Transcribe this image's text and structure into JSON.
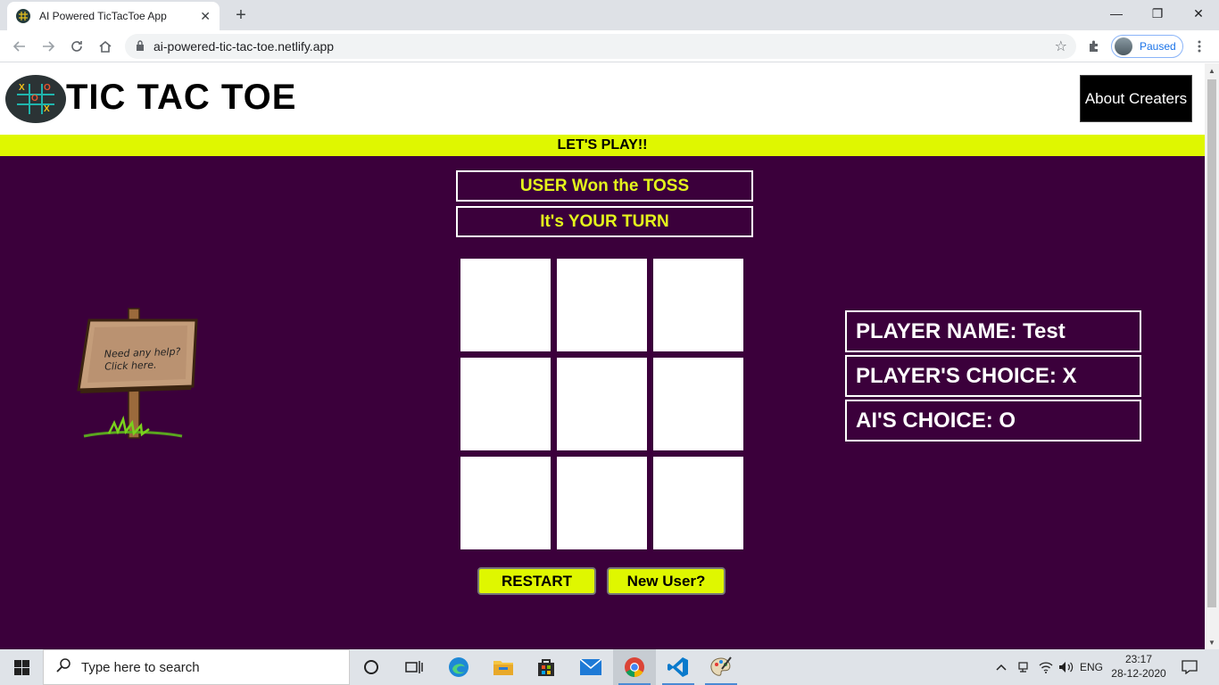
{
  "browser": {
    "tab_title": "AI Powered TicTacToe App",
    "tab_close": "✕",
    "new_tab": "+",
    "url": "ai-powered-tic-tac-toe.netlify.app",
    "profile_status": "Paused",
    "window_controls": {
      "minimize": "—",
      "maximize": "❐",
      "close": "✕"
    }
  },
  "header": {
    "title": "TIC TAC TOE",
    "about_button": "About Creaters",
    "logo_letters": [
      "X",
      "O",
      "X",
      "O"
    ]
  },
  "banner": {
    "text": "LET'S PLAY!!"
  },
  "game": {
    "toss_message": "USER Won the TOSS",
    "turn_message": "It's YOUR TURN",
    "board": [
      "",
      "",
      "",
      "",
      "",
      "",
      "",
      "",
      ""
    ],
    "restart_label": "RESTART",
    "new_user_label": "New User?"
  },
  "help": {
    "line1": "Need any help?",
    "line2": "Click here."
  },
  "player_info": {
    "name": "PLAYER NAME: Test",
    "choice": "PLAYER'S CHOICE: X",
    "ai_choice": "AI'S CHOICE: O"
  },
  "taskbar": {
    "search_placeholder": "Type here to search",
    "language": "ENG",
    "time": "23:17",
    "date": "28-12-2020"
  },
  "colors": {
    "page_background": "#3b003b",
    "accent_yellow": "#dff700",
    "status_text": "#e4f51c"
  }
}
